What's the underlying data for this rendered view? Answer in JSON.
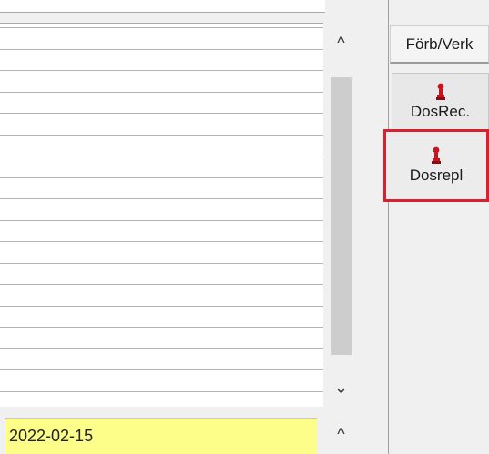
{
  "list": {
    "rows": 18
  },
  "scrollbar": {
    "up_glyph": "^",
    "down_glyph": "⌄"
  },
  "date_field": {
    "value": "2022-02-15",
    "scroll_up_glyph": "^"
  },
  "toolbar": {
    "forb_label": "Förb/Verk",
    "dosrec_label": "DosRec.",
    "dosrepl_label": "Dosrepl",
    "dosrec_icon": "red-pawn-icon",
    "dosrepl_icon": "red-pawn-icon"
  },
  "colors": {
    "date_field_bg": "#fdfd8a",
    "highlight_border": "#d6212f",
    "icon_red": "#c8141e"
  }
}
